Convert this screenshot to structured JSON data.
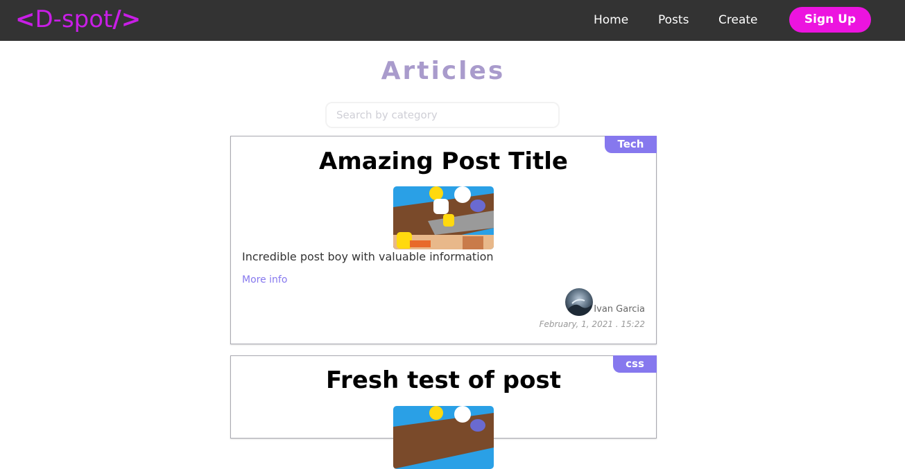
{
  "navbar": {
    "logo_open": "<",
    "logo_text": "D-spot",
    "logo_close": "/>",
    "links": [
      "Home",
      "Posts",
      "Create"
    ],
    "signup_label": "Sign Up"
  },
  "page": {
    "title": "Articles"
  },
  "search": {
    "placeholder": "Search by category"
  },
  "posts": [
    {
      "category": "Tech",
      "title": "Amazing Post Title",
      "body": "Incredible post boy with valuable information",
      "more_label": "More info",
      "author": "Ivan Garcia",
      "date": "February, 1, 2021 . 15:22"
    },
    {
      "category": "css",
      "title": "Fresh test of post"
    }
  ],
  "colors": {
    "navbar_bg": "#333333",
    "logo": "#c81ee6",
    "signup_bg": "#ec14df",
    "title": "#a99bcc",
    "badge": "#8678ee",
    "link": "#8678ee"
  }
}
